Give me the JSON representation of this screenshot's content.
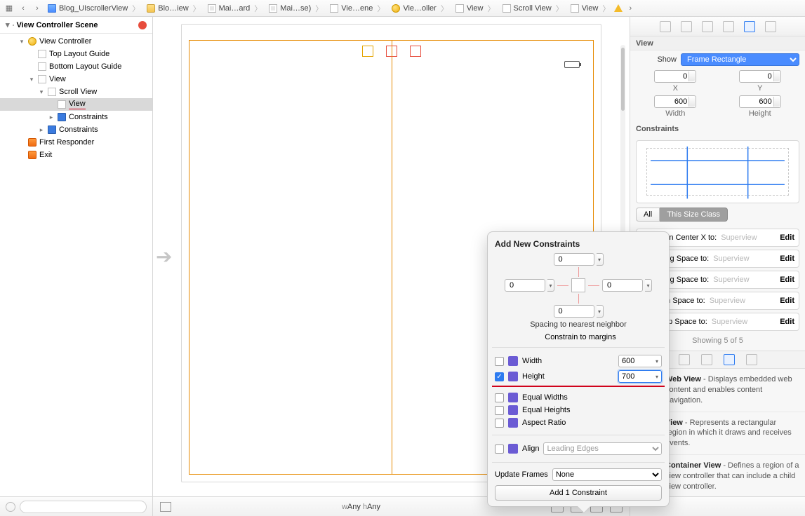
{
  "breadcrumbs": {
    "items": [
      {
        "icon": "blue-doc",
        "label": "Blog_UIscrollerView"
      },
      {
        "icon": "folder",
        "label": "Blo…iew"
      },
      {
        "icon": "ib-doc",
        "label": "Mai…ard"
      },
      {
        "icon": "ib-doc",
        "label": "Mai…se)"
      },
      {
        "icon": "plain-view",
        "label": "Vie…ene"
      },
      {
        "icon": "yellow-ball",
        "label": "Vie…oller"
      },
      {
        "icon": "plain-view",
        "label": "View"
      },
      {
        "icon": "plain-view",
        "label": "Scroll View"
      },
      {
        "icon": "plain-view",
        "label": "View"
      }
    ]
  },
  "navigator": {
    "scene_header": "View Controller Scene",
    "rows": [
      {
        "depth": 1,
        "disclosure": "▾",
        "icon": "yellow-ball",
        "label": "View Controller"
      },
      {
        "depth": 2,
        "disclosure": "",
        "icon": "guide",
        "label": "Top Layout Guide"
      },
      {
        "depth": 2,
        "disclosure": "",
        "icon": "guide",
        "label": "Bottom Layout Guide"
      },
      {
        "depth": 2,
        "disclosure": "▾",
        "icon": "plain",
        "label": "View"
      },
      {
        "depth": 3,
        "disclosure": "▾",
        "icon": "plain",
        "label": "Scroll View"
      },
      {
        "depth": 4,
        "disclosure": "",
        "icon": "plain",
        "label": "View",
        "selected": true,
        "redunder": true
      },
      {
        "depth": 4,
        "disclosure": "▸",
        "icon": "constraints",
        "label": "Constraints"
      },
      {
        "depth": 3,
        "disclosure": "▸",
        "icon": "constraints",
        "label": "Constraints"
      },
      {
        "depth": 1,
        "disclosure": "",
        "icon": "orange-cube",
        "label": "First Responder"
      },
      {
        "depth": 1,
        "disclosure": "",
        "icon": "orange-cube",
        "label": "Exit"
      }
    ]
  },
  "size_class": {
    "w_prefix": "w",
    "w": "Any",
    "h_prefix": "h",
    "h": "Any"
  },
  "inspector": {
    "header": "View",
    "show_label": "Show",
    "show_value": "Frame Rectangle",
    "x": "0",
    "y": "0",
    "width": "600",
    "height": "600",
    "cap_x": "X",
    "cap_y": "Y",
    "cap_w": "Width",
    "cap_h": "Height",
    "constraints_label": "Constraints",
    "seg_all": "All",
    "seg_this": "This Size Class",
    "items": [
      {
        "label": "Align Center X to:",
        "to": "Superview"
      },
      {
        "label": "…ing Space to:",
        "to": "Superview"
      },
      {
        "label": "…ing Space to:",
        "to": "Superview"
      },
      {
        "label": "…m Space to:",
        "to": "Superview"
      },
      {
        "label": "…op Space to:",
        "to": "Superview"
      }
    ],
    "edit": "Edit",
    "showing": "Showing 5 of 5",
    "library": [
      {
        "title": "Web View",
        "desc": " - Displays embedded web content and enables content navigation."
      },
      {
        "title": "View",
        "desc": " - Represents a rectangular region in which it draws and receives events."
      },
      {
        "title": "Container View",
        "desc": " - Defines a region of a view controller that can include a child view controller."
      }
    ]
  },
  "popover": {
    "title": "Add New Constraints",
    "top": "0",
    "left": "0",
    "right": "0",
    "bottom": "0",
    "spacing_note": "Spacing to nearest neighbor",
    "constrain_margins": "Constrain to margins",
    "width_label": "Width",
    "width_val": "600",
    "height_label": "Height",
    "height_val": "700",
    "equal_widths": "Equal Widths",
    "equal_heights": "Equal Heights",
    "aspect": "Aspect Ratio",
    "align_label": "Align",
    "align_placeholder": "Leading Edges",
    "update_label": "Update Frames",
    "update_value": "None",
    "add_btn": "Add 1 Constraint"
  }
}
